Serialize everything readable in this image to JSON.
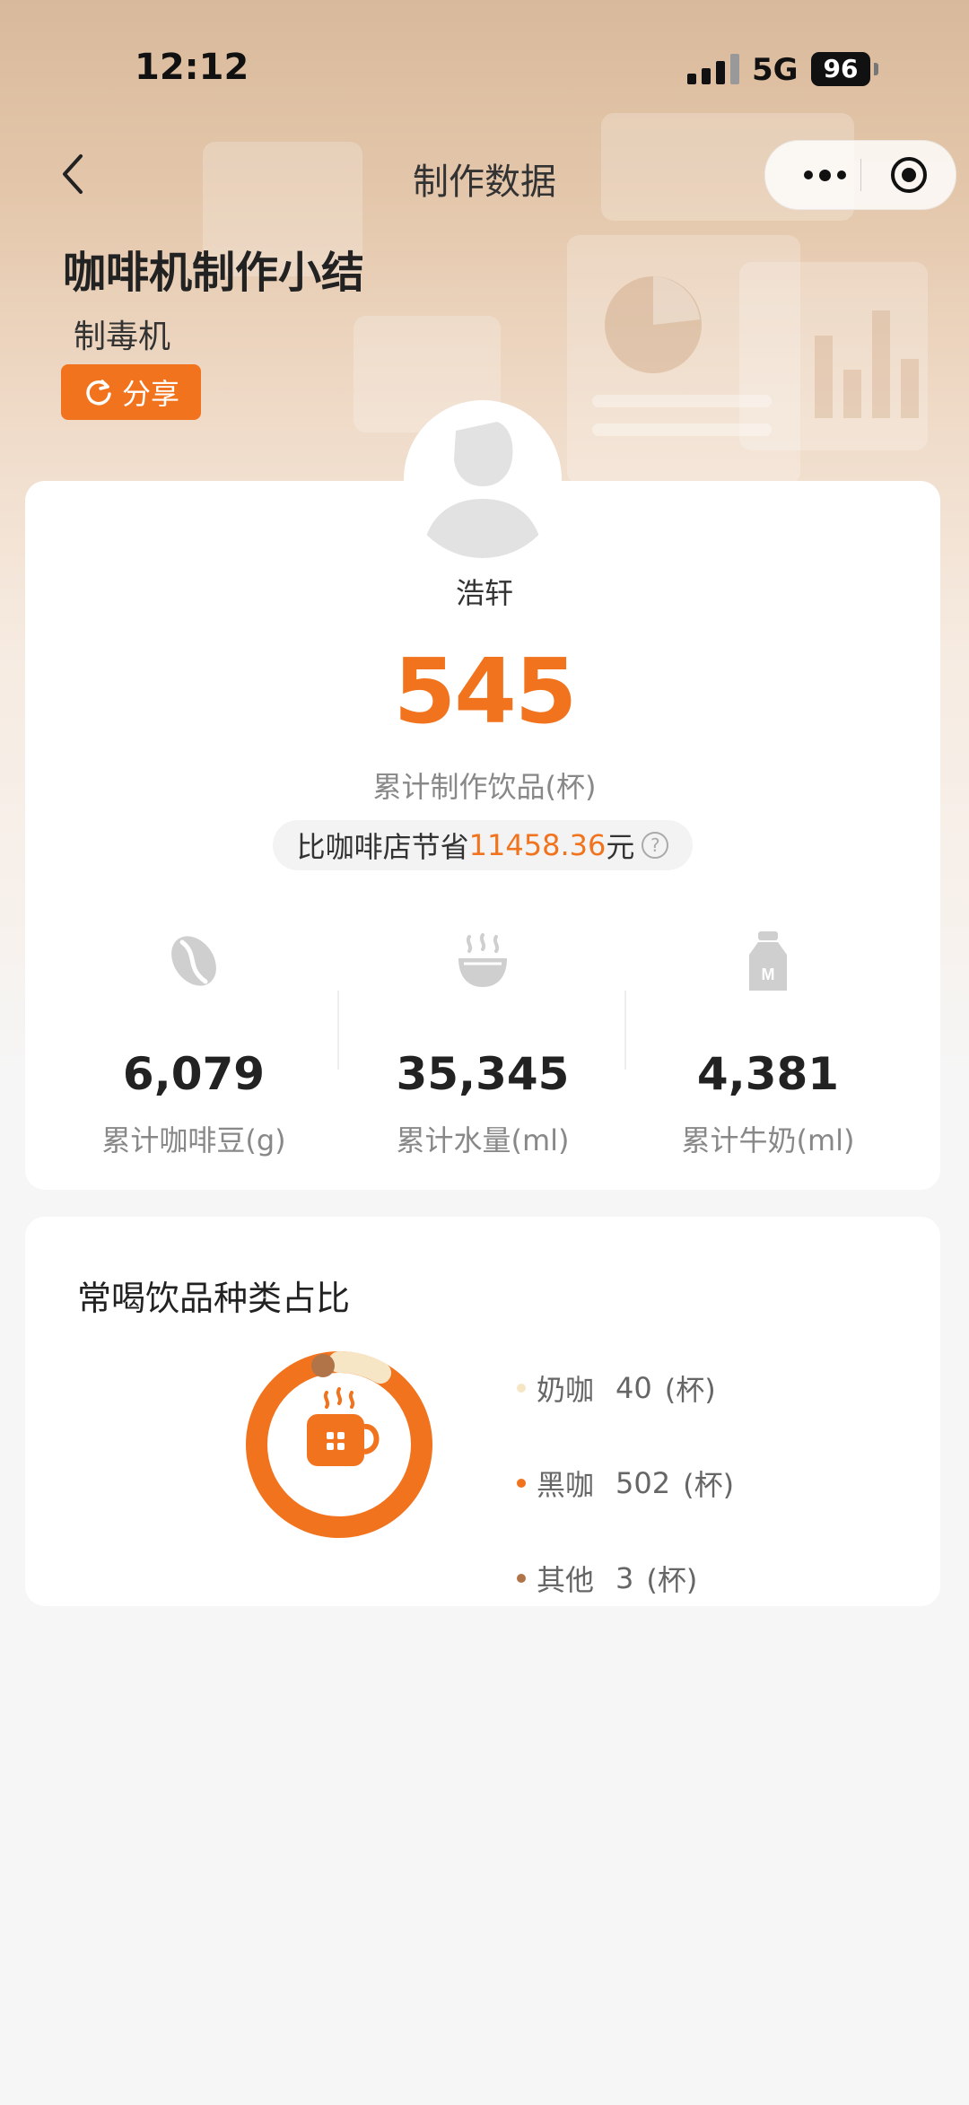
{
  "status_bar": {
    "time": "12:12",
    "network": "5G",
    "battery": "96"
  },
  "nav": {
    "title": "制作数据"
  },
  "header": {
    "title": "咖啡机制作小结",
    "machine_name": "制毒机",
    "share_label": "分享"
  },
  "user": {
    "name": "浩轩"
  },
  "summary": {
    "drinks_count": "545",
    "drinks_label": "累计制作饮品(杯)",
    "savings_prefix": "比咖啡店节省",
    "savings_amount": "11458.36",
    "savings_suffix": "元"
  },
  "stats": [
    {
      "icon": "coffee-bean-icon",
      "value": "6,079",
      "label": "累计咖啡豆(g)"
    },
    {
      "icon": "hot-water-icon",
      "value": "35,345",
      "label": "累计水量(ml)"
    },
    {
      "icon": "milk-bottle-icon",
      "value": "4,381",
      "label": "累计牛奶(ml)"
    }
  ],
  "distribution": {
    "title": "常喝饮品种类占比",
    "items": [
      {
        "name": "奶咖",
        "count": "40",
        "unit": "(杯)",
        "color": "#f6e6c6"
      },
      {
        "name": "黑咖",
        "count": "502",
        "unit": "(杯)",
        "color": "#f2731d"
      },
      {
        "name": "其他",
        "count": "3",
        "unit": "(杯)",
        "color": "#b07448"
      }
    ]
  },
  "colors": {
    "accent": "#f2731d",
    "milk_coffee": "#f6e6c6",
    "other": "#b07448"
  }
}
